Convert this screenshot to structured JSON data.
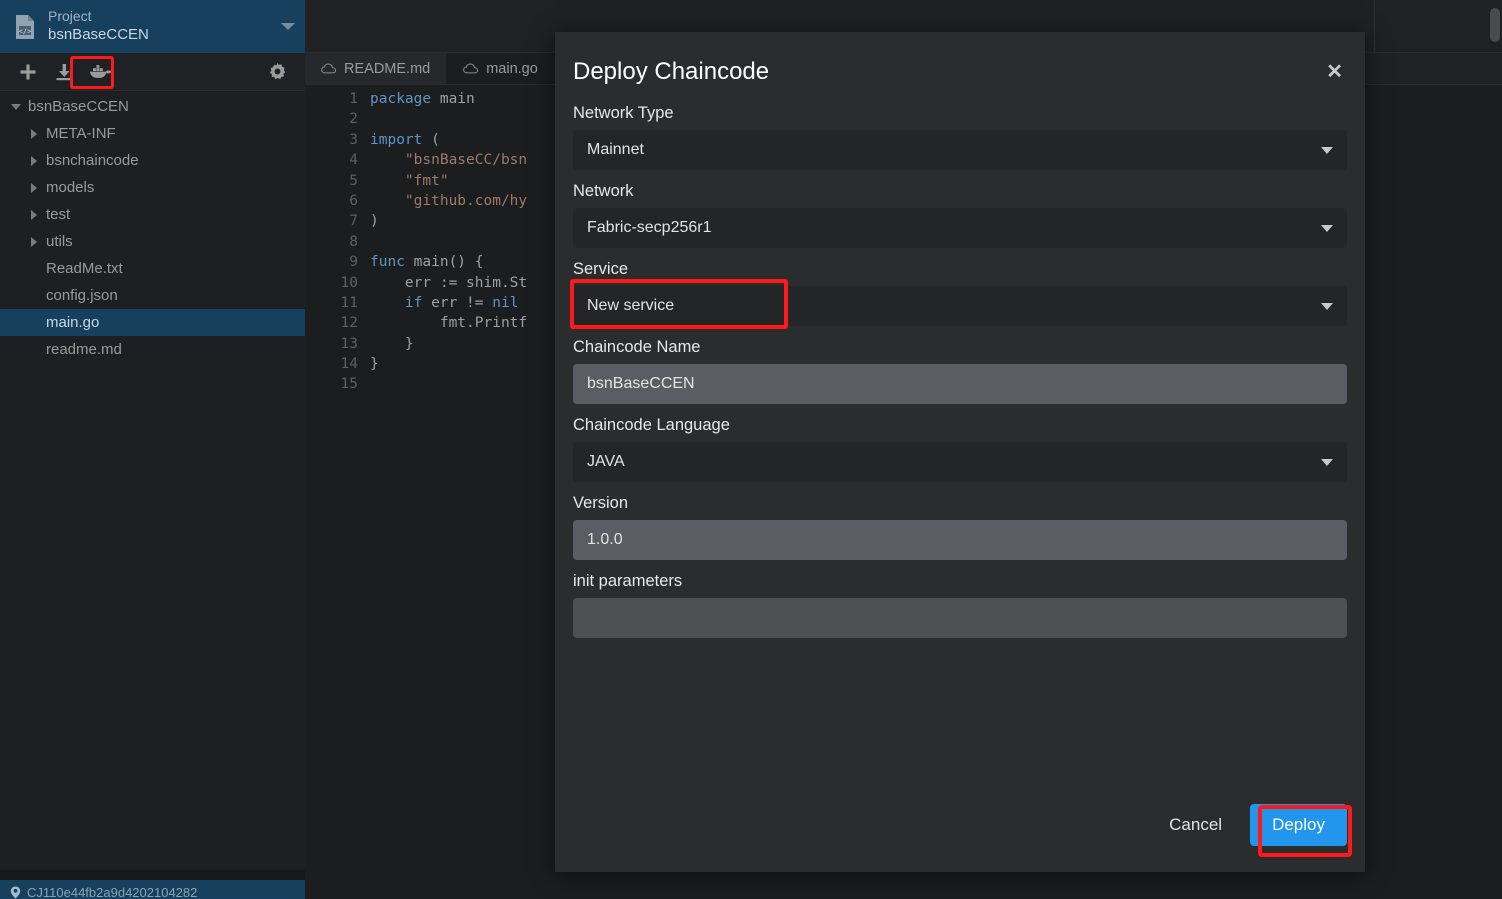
{
  "sidebar": {
    "project": {
      "label": "Project",
      "name": "bsnBaseCCEN",
      "doc_icon": "document-code-icon",
      "caret_icon": "chevron-down-icon"
    },
    "toolbar": {
      "add_icon": "plus-icon",
      "import_icon": "download-icon",
      "docker_icon": "docker-whale-icon",
      "settings_icon": "gear-icon"
    },
    "tree": [
      {
        "label": "bsnBaseCCEN",
        "depth": 0,
        "twist": "down",
        "selected": false
      },
      {
        "label": "META-INF",
        "depth": 1,
        "twist": "right",
        "selected": false
      },
      {
        "label": "bsnchaincode",
        "depth": 1,
        "twist": "right",
        "selected": false
      },
      {
        "label": "models",
        "depth": 1,
        "twist": "right",
        "selected": false
      },
      {
        "label": "test",
        "depth": 1,
        "twist": "right",
        "selected": false
      },
      {
        "label": "utils",
        "depth": 1,
        "twist": "right",
        "selected": false
      },
      {
        "label": "ReadMe.txt",
        "depth": 1,
        "twist": "none",
        "selected": false
      },
      {
        "label": "config.json",
        "depth": 1,
        "twist": "none",
        "selected": false
      },
      {
        "label": "main.go",
        "depth": 1,
        "twist": "none",
        "selected": true
      },
      {
        "label": "readme.md",
        "depth": 1,
        "twist": "none",
        "selected": false
      }
    ]
  },
  "statusbar": {
    "icon": "location-pin-icon",
    "text": "CJ110e44fb2a9d4202104282"
  },
  "editor": {
    "tabs": [
      {
        "label": "README.md",
        "icon": "cloud-icon",
        "active": true
      },
      {
        "label": "main.go",
        "icon": "cloud-icon",
        "active": false
      }
    ],
    "lines": [
      {
        "n": "1",
        "text": "package main"
      },
      {
        "n": "2",
        "text": ""
      },
      {
        "n": "3",
        "text": "import ("
      },
      {
        "n": "4",
        "text": "    \"bsnBaseCC/bsn"
      },
      {
        "n": "5",
        "text": "    \"fmt\""
      },
      {
        "n": "6",
        "text": "    \"github.com/hy"
      },
      {
        "n": "7",
        "text": ")"
      },
      {
        "n": "8",
        "text": ""
      },
      {
        "n": "9",
        "text": "func main() {"
      },
      {
        "n": "10",
        "text": "    err := shim.St"
      },
      {
        "n": "11",
        "text": "    if err != nil"
      },
      {
        "n": "12",
        "text": "        fmt.Printf"
      },
      {
        "n": "13",
        "text": "    }"
      },
      {
        "n": "14",
        "text": "}"
      },
      {
        "n": "15",
        "text": ""
      }
    ]
  },
  "modal": {
    "title": "Deploy Chaincode",
    "close_icon": "close-icon",
    "fields": [
      {
        "label": "Network Type",
        "value": "Mainnet",
        "kind": "select",
        "placeholder": ""
      },
      {
        "label": "Network",
        "value": "Fabric-secp256r1",
        "kind": "select",
        "placeholder": ""
      },
      {
        "label": "Service",
        "value": "New service",
        "kind": "select",
        "placeholder": "",
        "highlighted": true
      },
      {
        "label": "Chaincode Name",
        "value": "bsnBaseCCEN",
        "kind": "input",
        "placeholder": ""
      },
      {
        "label": "Chaincode Language",
        "value": "JAVA",
        "kind": "select",
        "placeholder": ""
      },
      {
        "label": "Version",
        "value": "1.0.0",
        "kind": "input",
        "placeholder": ""
      },
      {
        "label": "init parameters",
        "value": "",
        "kind": "input",
        "placeholder": ""
      }
    ],
    "cancel_label": "Cancel",
    "deploy_label": "Deploy",
    "accent_color": "#2196ec",
    "highlight_color": "#ff1a1a"
  }
}
